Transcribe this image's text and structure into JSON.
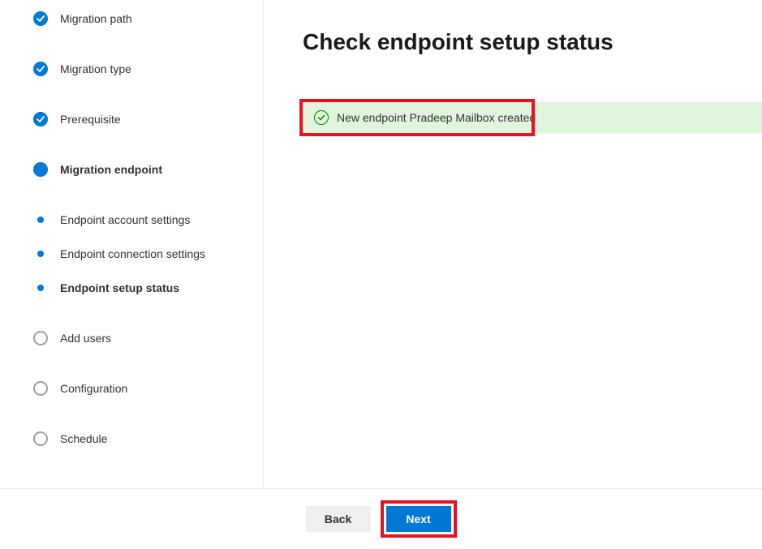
{
  "steps": {
    "migration_path": "Migration path",
    "migration_type": "Migration type",
    "prerequisite": "Prerequisite",
    "migration_endpoint": "Migration endpoint",
    "endpoint_account_settings": "Endpoint account settings",
    "endpoint_connection_settings": "Endpoint connection settings",
    "endpoint_setup_status": "Endpoint setup status",
    "add_users": "Add users",
    "configuration": "Configuration",
    "schedule": "Schedule"
  },
  "main": {
    "title": "Check endpoint setup status",
    "status_message": "New endpoint Pradeep Mailbox created"
  },
  "footer": {
    "back": "Back",
    "next": "Next"
  }
}
